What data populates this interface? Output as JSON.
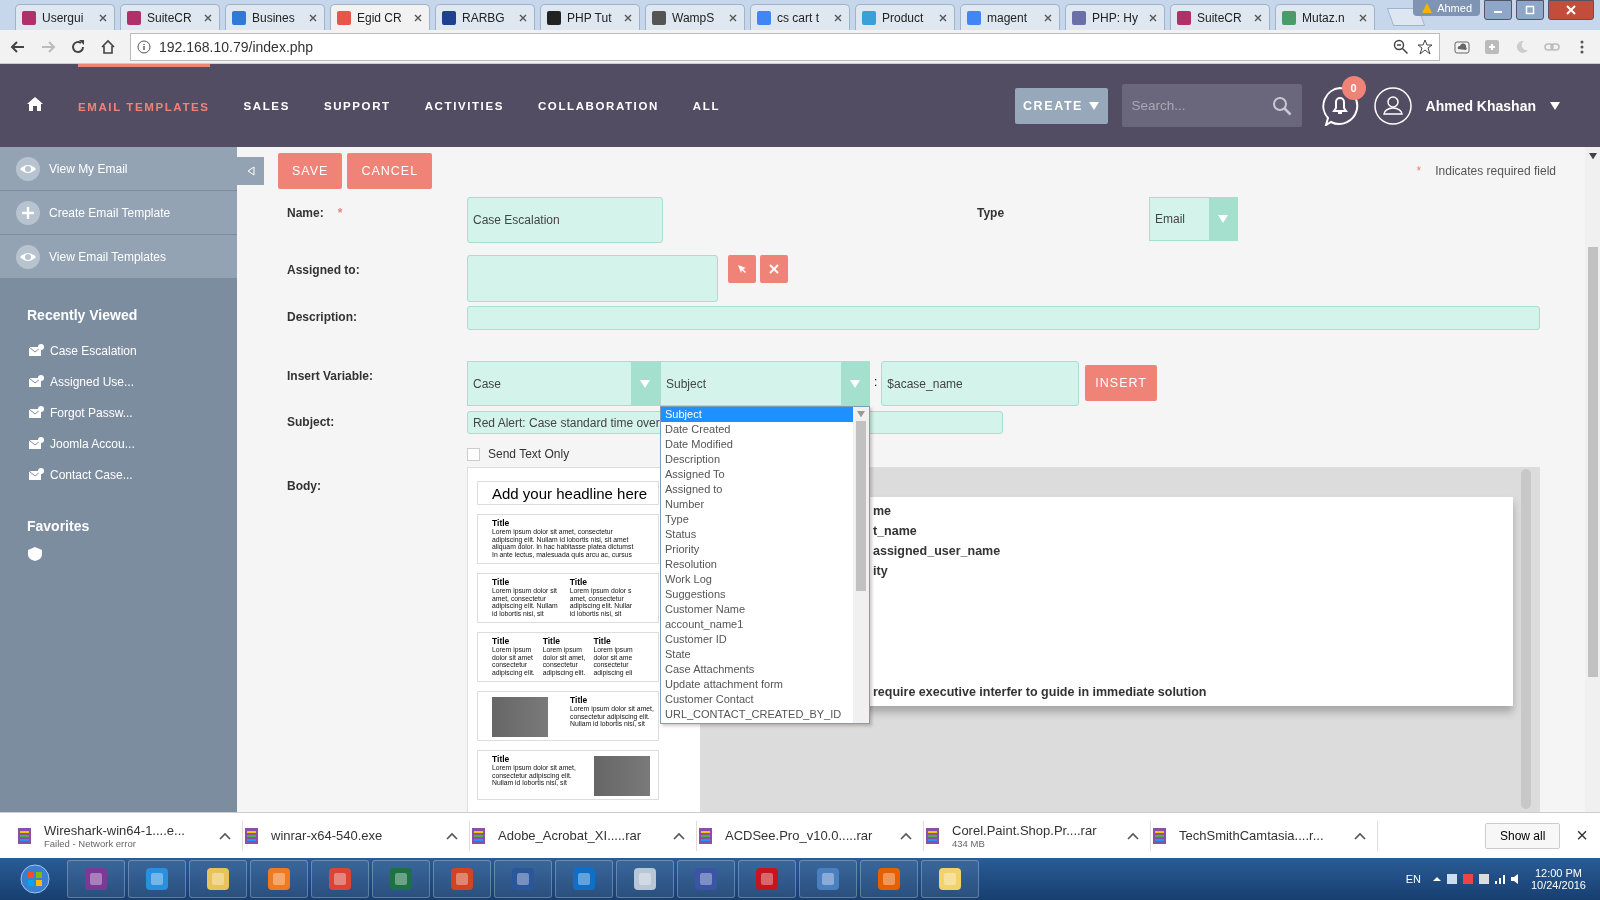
{
  "browser": {
    "tabs": [
      {
        "title": "Usergui",
        "color": "#b0306a",
        "selected": false
      },
      {
        "title": "SuiteCR",
        "color": "#b0306a",
        "selected": false
      },
      {
        "title": "Busines",
        "color": "#2d7bd6",
        "selected": false
      },
      {
        "title": "Egid CR",
        "color": "#e8564a",
        "selected": true
      },
      {
        "title": "RARBG",
        "color": "#1f3f8f",
        "selected": false
      },
      {
        "title": "PHP Tut",
        "color": "#222222",
        "selected": false
      },
      {
        "title": "WampS",
        "color": "#555555",
        "selected": false
      },
      {
        "title": "cs cart t",
        "color": "#4285f4",
        "selected": false
      },
      {
        "title": "Product",
        "color": "#3aa0d8",
        "selected": false
      },
      {
        "title": "magent",
        "color": "#4285f4",
        "selected": false
      },
      {
        "title": "PHP: Hy",
        "color": "#6a6fa8",
        "selected": false
      },
      {
        "title": "SuiteCR",
        "color": "#b0306a",
        "selected": false
      },
      {
        "title": "Mutaz.n",
        "color": "#4a9a6a",
        "selected": false
      }
    ],
    "window_user": "Ahmed",
    "address": "192.168.10.79/index.php"
  },
  "nav": {
    "items": [
      {
        "label": "EMAIL TEMPLATES",
        "selected": true
      },
      {
        "label": "SALES",
        "selected": false
      },
      {
        "label": "SUPPORT",
        "selected": false
      },
      {
        "label": "ACTIVITIES",
        "selected": false
      },
      {
        "label": "COLLABORATION",
        "selected": false
      },
      {
        "label": "ALL",
        "selected": false
      }
    ],
    "create": "CREATE",
    "search_placeholder": "Search...",
    "notifications": "0",
    "user": "Ahmed Khashan"
  },
  "sidebar": {
    "actions": [
      {
        "label": "View My Email",
        "kind": "view"
      },
      {
        "label": "Create Email Template",
        "kind": "create"
      },
      {
        "label": "View Email Templates",
        "kind": "view"
      }
    ],
    "recent_title": "Recently Viewed",
    "recent": [
      "Case Escalation",
      "Assigned Use...",
      "Forgot Passw...",
      "Joomla Accou...",
      "Contact Case..."
    ],
    "favorites_title": "Favorites"
  },
  "toolbar": {
    "buttons": [
      "SAVE",
      "CANCEL"
    ],
    "required_mark": "*",
    "required_note": "Indicates required field"
  },
  "form": {
    "name": {
      "label": "Name:",
      "required_mark": "*",
      "value": "Case Escalation"
    },
    "type": {
      "label": "Type",
      "value": "Email"
    },
    "assigned": {
      "label": "Assigned to:"
    },
    "description": {
      "label": "Description:"
    },
    "insert_variable": {
      "label": "Insert Variable:",
      "module": "Case",
      "field": "Subject",
      "separator": ":",
      "variable": "$acase_name",
      "button": "INSERT"
    },
    "subject": {
      "label": "Subject:",
      "value": "Red Alert: Case standard time over"
    },
    "send_text_only": {
      "label": "Send Text Only",
      "checked": false
    },
    "body": {
      "label": "Body:",
      "headline": "Add your headline here",
      "templates": [
        {
          "kind": "one-column",
          "columns": [
            {
              "title": "Title",
              "lines": [
                "Lorem ipsum dolor sit amet, consectetur",
                "adipiscing elit. Nullam id lobortis nisi, sit amet",
                "aliquam dolor. In hac habitasse platea dictumst",
                "In ante lectus, malesuada quis arcu ac, cursus"
              ]
            }
          ]
        },
        {
          "kind": "two-column",
          "columns": [
            {
              "title": "Title",
              "lines": [
                "Lorem ipsum dolor sit",
                "amet, consectetur",
                "adipiscing elit. Nullam",
                "id lobortis nisi, sit"
              ]
            },
            {
              "title": "Title",
              "lines": [
                "Lorem ipsum dolor s",
                "amet, consectetur",
                "adipiscing elit. Nullar",
                "id lobortis nisi, sit"
              ]
            }
          ]
        },
        {
          "kind": "three-column",
          "columns": [
            {
              "title": "Title",
              "lines": [
                "Lorem ipsum",
                "dolor sit amet",
                "consectetur",
                "adipiscing elit."
              ]
            },
            {
              "title": "Title",
              "lines": [
                "Lorem ipsum",
                "dolor sit amet,",
                "consectetur",
                "adipiscing elit."
              ]
            },
            {
              "title": "Title",
              "lines": [
                "Lorem ipsum",
                "dolor sit ame",
                "consectetur",
                "adipiscing eli"
              ]
            }
          ]
        },
        {
          "kind": "image-left",
          "columns": [
            {
              "title": "Title",
              "lines": [
                "Lorem ipsum dolor sit amet,",
                "consectetur adipiscing elit.",
                "Nullam id lobortis nisi, sit"
              ]
            }
          ]
        },
        {
          "kind": "image-right",
          "columns": [
            {
              "title": "Title",
              "lines": [
                "Lorem ipsum dolor sit amet,",
                "consectetur adipiscing elit.",
                "Nullam id lobortis nisi, sit"
              ]
            }
          ]
        }
      ],
      "document_lines": [
        "me",
        "t_name",
        "assigned_user_name",
        "ity"
      ],
      "document_closing": "require executive interfer to guide in immediate solution"
    }
  },
  "field_dropdown": {
    "options": [
      {
        "label": "Subject",
        "selected": true
      },
      {
        "label": "Date Created",
        "selected": false
      },
      {
        "label": "Date Modified",
        "selected": false
      },
      {
        "label": "Description",
        "selected": false
      },
      {
        "label": "Assigned To",
        "selected": false
      },
      {
        "label": "Assigned to",
        "selected": false
      },
      {
        "label": "Number",
        "selected": false
      },
      {
        "label": "Type",
        "selected": false
      },
      {
        "label": "Status",
        "selected": false
      },
      {
        "label": "Priority",
        "selected": false
      },
      {
        "label": "Resolution",
        "selected": false
      },
      {
        "label": "Work Log",
        "selected": false
      },
      {
        "label": "Suggestions",
        "selected": false
      },
      {
        "label": "Customer Name",
        "selected": false
      },
      {
        "label": "account_name1",
        "selected": false
      },
      {
        "label": "Customer ID",
        "selected": false
      },
      {
        "label": "State",
        "selected": false
      },
      {
        "label": "Case Attachments",
        "selected": false
      },
      {
        "label": "Update attachment form",
        "selected": false
      },
      {
        "label": "Customer Contact",
        "selected": false
      },
      {
        "label": "URL_CONTACT_CREATED_BY_ID",
        "selected": false
      }
    ]
  },
  "downloads": {
    "items": [
      {
        "name": "Wireshark-win64-1....e...",
        "status": "Failed - Network error"
      },
      {
        "name": "winrar-x64-540.exe"
      },
      {
        "name": "Adobe_Acrobat_XI.....rar"
      },
      {
        "name": "ACDSee.Pro_v10.0.....rar"
      },
      {
        "name": "Corel.Paint.Shop.Pr....rar",
        "status": "434 MB"
      },
      {
        "name": "TechSmithCamtasia....r..."
      }
    ],
    "show_all": "Show all",
    "close": "×"
  },
  "taskbar": {
    "language": "EN",
    "time": "12:00 PM",
    "date": "10/24/2016"
  }
}
